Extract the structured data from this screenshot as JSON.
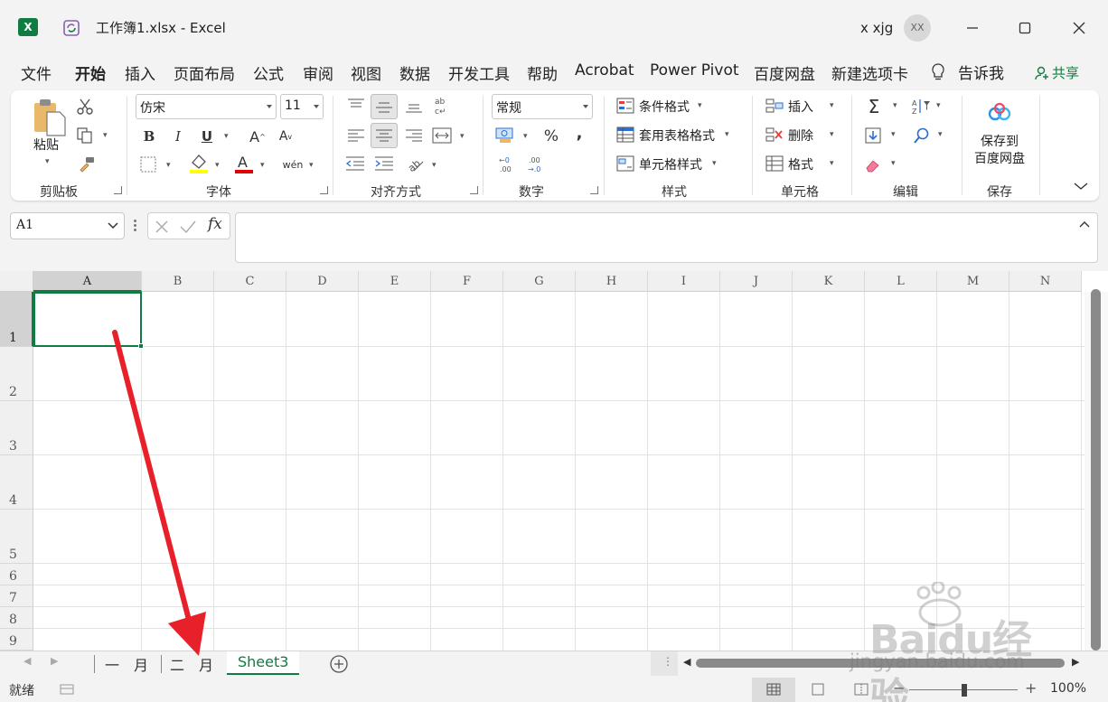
{
  "window": {
    "title": "工作簿1.xlsx  -  Excel",
    "user": "x xjg",
    "avatar_initials": "XX",
    "app_icon": "X"
  },
  "menu": {
    "tabs": [
      "文件",
      "开始",
      "插入",
      "页面布局",
      "公式",
      "审阅",
      "视图",
      "数据",
      "开发工具",
      "帮助",
      "Acrobat",
      "Power Pivot",
      "百度网盘",
      "新建选项卡"
    ],
    "active_tab": "开始",
    "tell_me": "告诉我",
    "share": "共享"
  },
  "ribbon": {
    "clipboard": {
      "paste_label": "粘贴",
      "group_label": "剪贴板"
    },
    "font": {
      "font_name": "仿宋",
      "font_size": "11",
      "group_label": "字体"
    },
    "alignment": {
      "group_label": "对齐方式"
    },
    "number": {
      "format": "常规",
      "percent": "%",
      "comma": ",",
      "group_label": "数字"
    },
    "styles": {
      "conditional": "条件格式",
      "table": "套用表格格式",
      "cell_styles": "单元格样式",
      "group_label": "样式"
    },
    "cells": {
      "insert": "插入",
      "delete": "删除",
      "format": "格式",
      "group_label": "单元格"
    },
    "editing": {
      "group_label": "编辑"
    },
    "save": {
      "label": "保存到\n百度网盘",
      "group_label": "保存"
    }
  },
  "formula_bar": {
    "name_box": "A1",
    "formula": "",
    "fx": "fx"
  },
  "grid": {
    "columns": [
      "A",
      "B",
      "C",
      "D",
      "E",
      "F",
      "G",
      "H",
      "I",
      "J",
      "K",
      "L",
      "M",
      "N"
    ],
    "rows": [
      "1",
      "2",
      "3",
      "4",
      "5",
      "6",
      "7",
      "8",
      "9"
    ],
    "active_cell": "A1"
  },
  "sheets": {
    "tabs": [
      "一　月",
      "二　月",
      "Sheet3"
    ],
    "active": "Sheet3"
  },
  "status": {
    "text": "就绪",
    "zoom": "100%"
  },
  "watermark": {
    "brand": "Baidu经验",
    "url": "jingyan.baidu.com"
  },
  "colors": {
    "accent": "#107c41",
    "arrow": "#e8202a"
  }
}
